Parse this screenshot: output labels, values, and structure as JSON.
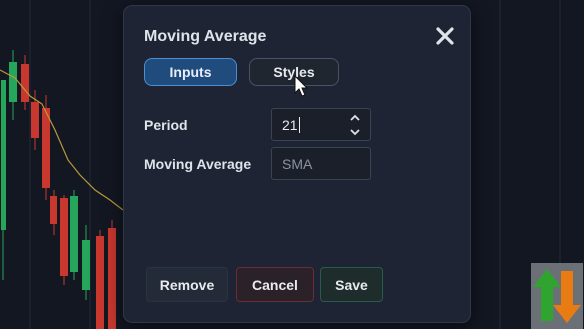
{
  "dialog": {
    "title": "Moving Average",
    "tabs": [
      {
        "label": "Inputs",
        "active": true
      },
      {
        "label": "Styles",
        "active": false
      }
    ],
    "fields": {
      "period": {
        "label": "Period",
        "value": "21"
      },
      "moving_average": {
        "label": "Moving Average",
        "value": "SMA"
      }
    },
    "buttons": {
      "remove": "Remove",
      "cancel": "Cancel",
      "save": "Save"
    }
  },
  "colors": {
    "background": "#131722",
    "bull_candle": "#26a65b",
    "bear_candle": "#c8382f",
    "ma_line": "#b89a3a",
    "accent": "#4b8fd3"
  },
  "icons": [
    "close-icon",
    "chevron-up-icon",
    "chevron-down-icon",
    "mouse-pointer-icon",
    "up-down-arrows-logo"
  ]
}
